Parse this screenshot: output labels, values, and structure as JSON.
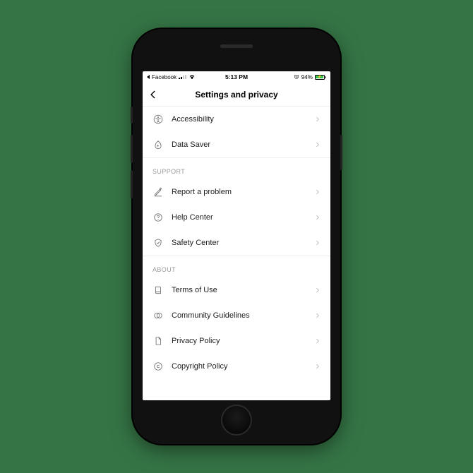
{
  "statusbar": {
    "back_app": "Facebook",
    "time": "5:13 PM",
    "battery_pct": "94%"
  },
  "navbar": {
    "title": "Settings and privacy"
  },
  "sections": {
    "top": {
      "items": [
        {
          "label": "Accessibility"
        },
        {
          "label": "Data Saver"
        }
      ]
    },
    "support": {
      "header": "SUPPORT",
      "items": [
        {
          "label": "Report a problem"
        },
        {
          "label": "Help Center"
        },
        {
          "label": "Safety Center"
        }
      ]
    },
    "about": {
      "header": "ABOUT",
      "items": [
        {
          "label": "Terms of Use"
        },
        {
          "label": "Community Guidelines"
        },
        {
          "label": "Privacy Policy"
        },
        {
          "label": "Copyright Policy"
        }
      ]
    }
  }
}
